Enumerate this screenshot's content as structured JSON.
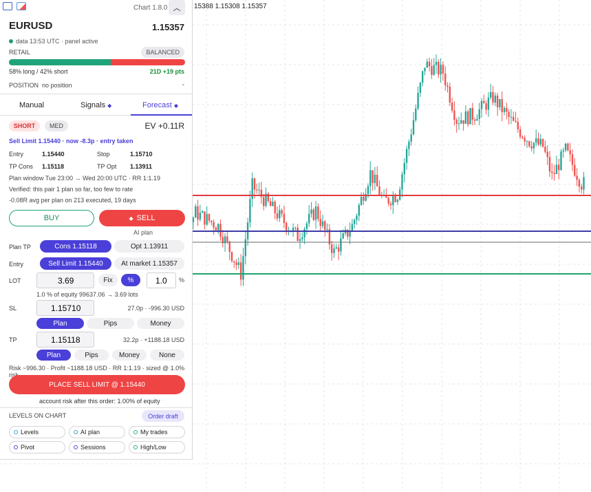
{
  "ohlc_text": "15388 1.15308 1.15357",
  "app": {
    "version": "Chart 1.8.0"
  },
  "instrument": {
    "symbol": "EURUSD",
    "price": "1.15357",
    "meta": "data 13:53 UTC · panel active"
  },
  "retail": {
    "label": "RETAIL",
    "badge": "BALANCED",
    "long_pct": 58,
    "summary": "58% long / 42% short",
    "delta": "21D +19 pts"
  },
  "position": {
    "label": "POSITION",
    "value": "no position",
    "dash": "-"
  },
  "tabs": [
    {
      "label": "Manual"
    },
    {
      "label": "Signals",
      "marker": "◆"
    },
    {
      "label": "Forecast",
      "marker": "◆"
    }
  ],
  "forecast": {
    "direction": "SHORT",
    "confidence": "MED",
    "ev": "EV +0.11R",
    "headline": "Sell Limit 1.15440 · now -8.3p · entry taken",
    "entry_label": "Entry",
    "entry": "1.15440",
    "stop_label": "Stop",
    "stop": "1.15710",
    "tpcons_label": "TP Cons",
    "tpcons": "1.15118",
    "tpopt_label": "TP Opt",
    "tpopt": "1.13911",
    "window": "Plan window Tue 23:00 → Wed 20:00 UTC · RR 1:1.19",
    "verified": "Verified: this pair 1 plan so far, too few to rate",
    "avg": "-0.08R avg per plan on 213 executed, 19 days"
  },
  "actions": {
    "buy": "BUY",
    "sell": "SELL",
    "sell_icon": "◆",
    "ai_plan": "AI plan"
  },
  "order": {
    "plan_tp_label": "Plan TP",
    "plan_tp_cons": "Cons 1.15118",
    "plan_tp_opt": "Opt 1.13911",
    "entry_label": "Entry",
    "entry_limit": "Sell Limit 1.15440",
    "entry_market": "At market 1.15357",
    "lot_label": "LOT",
    "lot_value": "3.69",
    "fix": "Fix",
    "pct_btn": "%",
    "pct_value": "1.0",
    "pct_sign": "%",
    "lot_note": "1.0 % of equity 99637.06 → 3.69 lots",
    "sl_label": "SL",
    "sl_value": "1.15710",
    "sl_info": "27.0p · -996.30 USD",
    "sl_modes": [
      "Plan",
      "Pips",
      "Money"
    ],
    "tp_label": "TP",
    "tp_value": "1.15118",
    "tp_info": "32.2p · +1188.18 USD",
    "tp_modes": [
      "Plan",
      "Pips",
      "Money",
      "None"
    ],
    "risk_line": "Risk ~996.30 · Profit ~1188.18 USD · RR 1:1.19 · sized @ 1.0% risk",
    "place": "PLACE SELL LIMIT @ 1.15440",
    "account_note": "account risk after this order: 1.00% of equity"
  },
  "levels": {
    "title": "LEVELS ON CHART",
    "draft": "Order draft",
    "chips": [
      {
        "label": "Levels",
        "color": "#3aa0c8"
      },
      {
        "label": "AI plan",
        "color": "#3aa0c8"
      },
      {
        "label": "My trades",
        "color": "#2fae7a"
      },
      {
        "label": "Pivot",
        "color": "#4a4fd0"
      },
      {
        "label": "Sessions",
        "color": "#4a4fd0"
      },
      {
        "label": "High/Low",
        "color": "#2fae7a"
      }
    ]
  },
  "colors": {
    "up": "#26a69a",
    "down": "#ef5350",
    "accent": "#4a3fd8",
    "sell": "#ef4444",
    "buy": "#1fa37a"
  },
  "chart_lines": [
    {
      "name": "stop-level",
      "price": 1.1571,
      "color": "#e0393e"
    },
    {
      "name": "entry-level",
      "price": 1.1544,
      "color": "#3d3aa8"
    },
    {
      "name": "current-price-level",
      "price": 1.15357,
      "color": "#6a6a6a"
    },
    {
      "name": "take-profit-level",
      "price": 1.15118,
      "color": "#1fa370"
    }
  ]
}
